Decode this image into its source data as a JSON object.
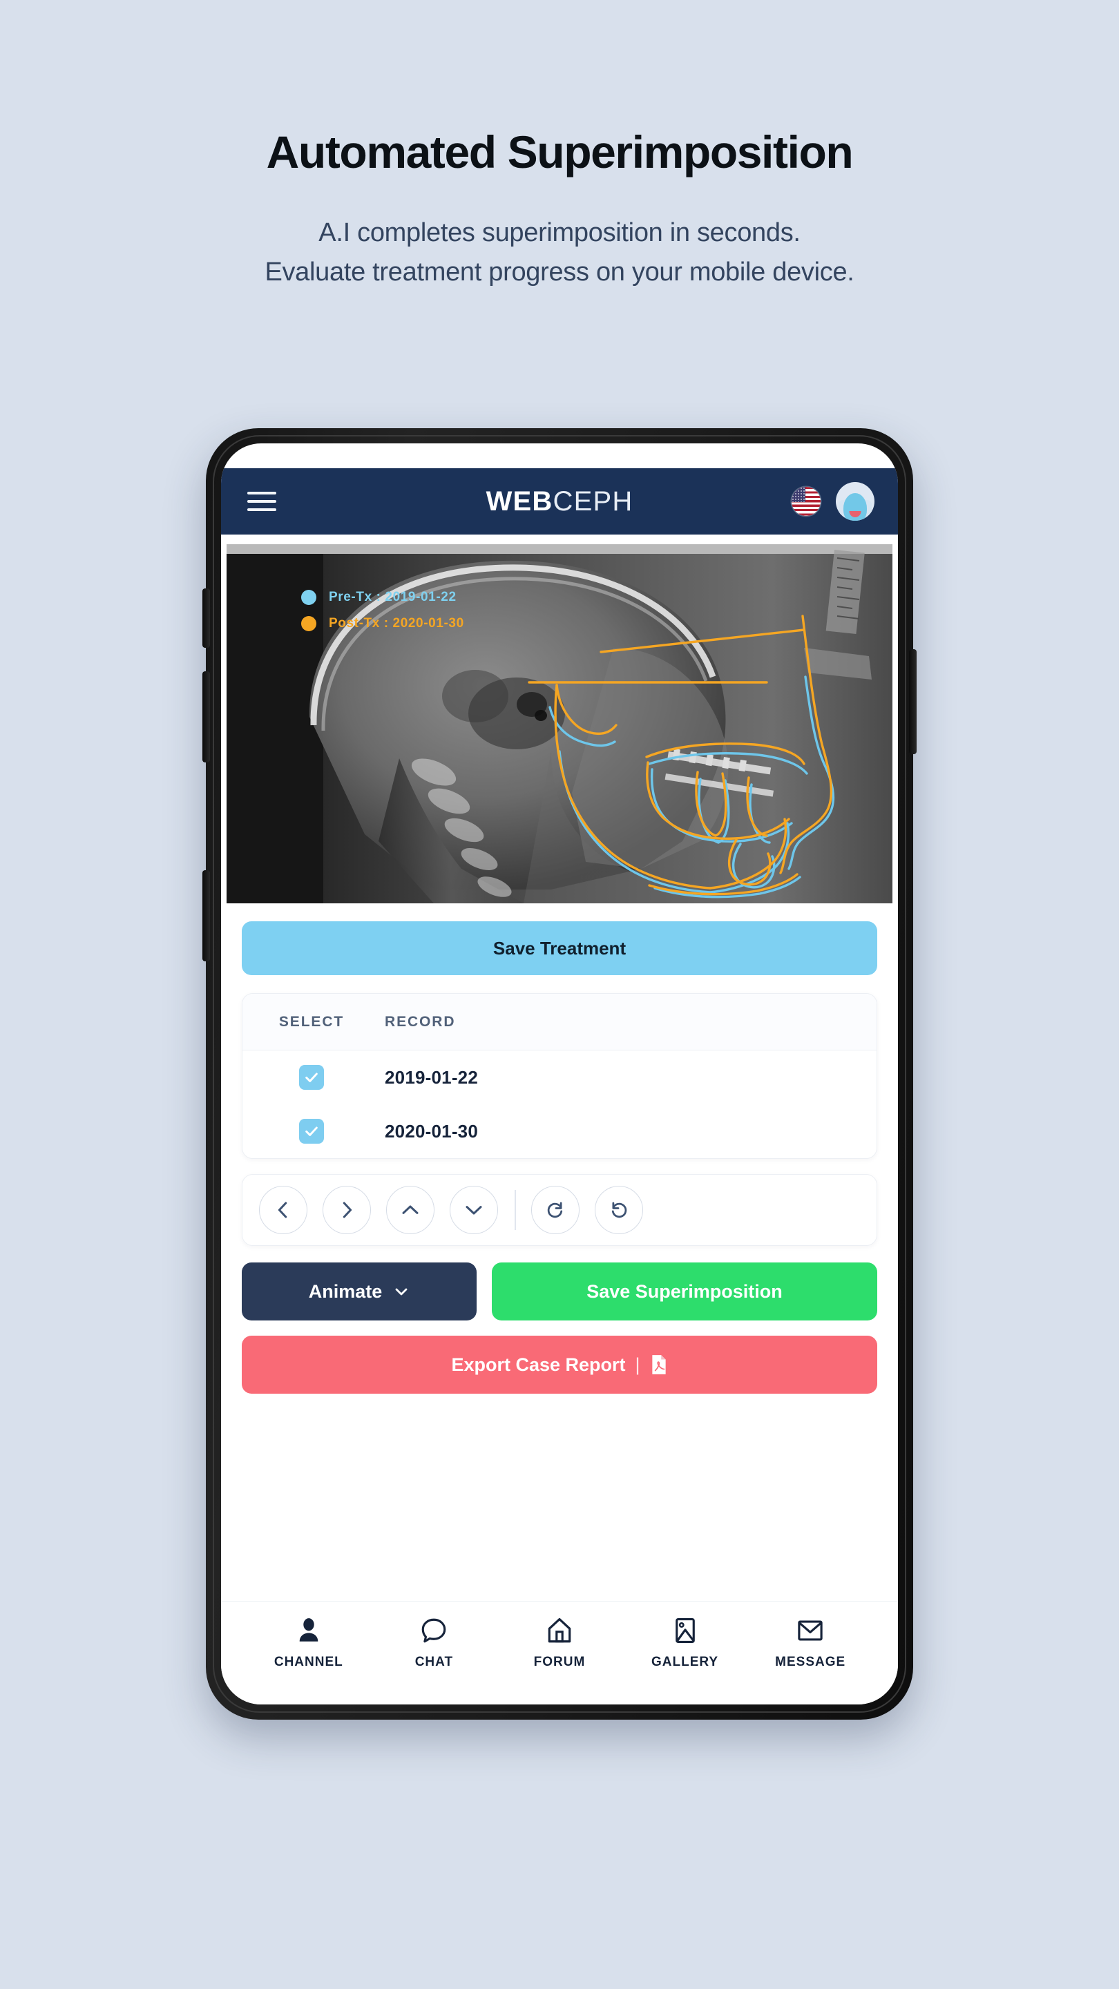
{
  "hero": {
    "title": "Automated Superimposition",
    "subtitle_line1": "A.I completes superimposition in seconds.",
    "subtitle_line2": "Evaluate treatment progress on your mobile device."
  },
  "appbar": {
    "menu_icon": "hamburger-menu-icon",
    "logo_bold": "WEB",
    "logo_light": "CEPH",
    "language_flag": "us-flag-icon",
    "avatar": "user-avatar-icon"
  },
  "xray": {
    "legend": [
      {
        "label": "Pre-Tx : 2019-01-22",
        "color": "#7fd1f0",
        "dot": "pre-tx-dot"
      },
      {
        "label": "Post-Tx : 2020-01-30",
        "color": "#f5a623",
        "dot": "post-tx-dot"
      }
    ],
    "tracing_colors": {
      "pre": "#6ec6ea",
      "post": "#f5a623"
    }
  },
  "save_treatment": {
    "label": "Save Treatment",
    "color": "#7ed0f2"
  },
  "records_table": {
    "headers": [
      "SELECT",
      "RECORD"
    ],
    "rows": [
      {
        "selected": true,
        "date": "2019-01-22"
      },
      {
        "selected": true,
        "date": "2020-01-30"
      }
    ]
  },
  "nav_pad": {
    "buttons": [
      {
        "name": "move-left-button",
        "icon": "chevron-left-icon"
      },
      {
        "name": "move-right-button",
        "icon": "chevron-right-icon"
      },
      {
        "name": "move-up-button",
        "icon": "chevron-up-icon"
      },
      {
        "name": "move-down-button",
        "icon": "chevron-down-icon"
      },
      {
        "name": "redo-button",
        "icon": "redo-icon"
      },
      {
        "name": "undo-button",
        "icon": "undo-icon"
      }
    ]
  },
  "actions": {
    "animate_label": "Animate",
    "animate_color": "#2b3b59",
    "save_superimposition_label": "Save Superimposition",
    "save_superimposition_color": "#2ddd6c",
    "export_label": "Export Case Report",
    "export_divider": "|",
    "export_color": "#f96a76",
    "export_icon": "pdf-file-icon"
  },
  "bottom_nav": [
    {
      "label": "CHANNEL",
      "icon": "person-icon",
      "active": true
    },
    {
      "label": "CHAT",
      "icon": "chat-bubble-icon",
      "active": false
    },
    {
      "label": "FORUM",
      "icon": "home-icon",
      "active": false
    },
    {
      "label": "GALLERY",
      "icon": "image-icon",
      "active": false
    },
    {
      "label": "MESSAGE",
      "icon": "envelope-icon",
      "active": false
    }
  ],
  "colors": {
    "page_background": "#d8e0ec",
    "appbar": "#1b3258",
    "accent_blue": "#7ed0f2",
    "accent_green": "#2ddd6c",
    "accent_red": "#f96a76",
    "dark_navy": "#2b3b59"
  }
}
